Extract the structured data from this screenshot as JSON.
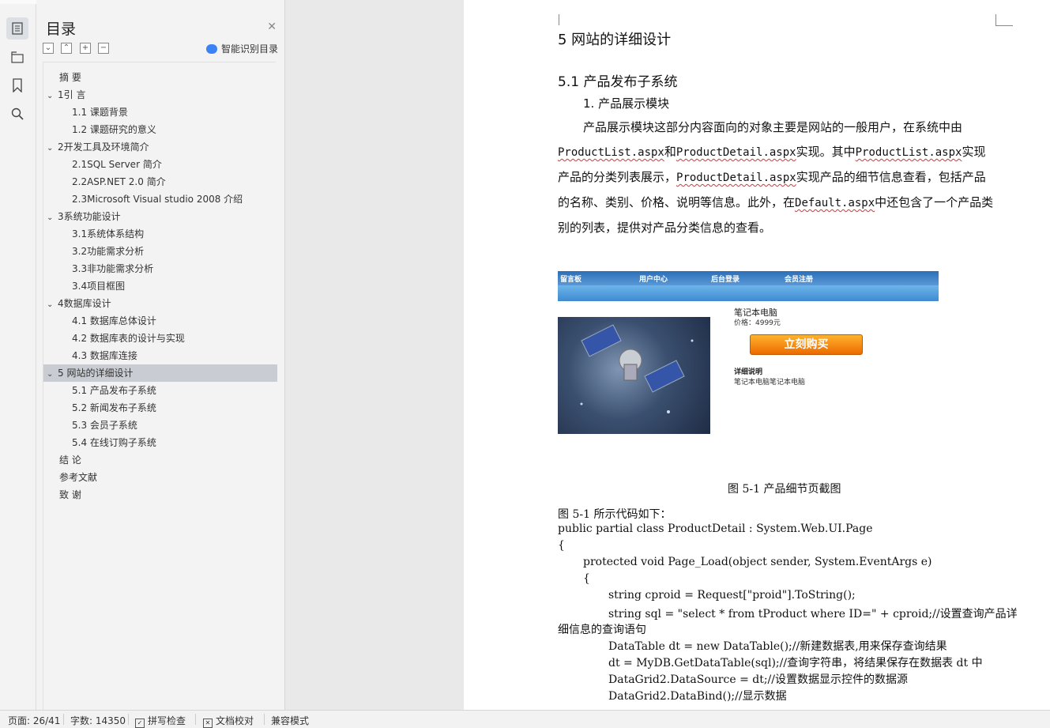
{
  "sidebar_icons": [
    "outline-icon",
    "navigation-icon",
    "bookmark-icon",
    "search-icon"
  ],
  "toc": {
    "title": "目录",
    "smart_label": "智能识别目录",
    "items": [
      {
        "label": "摘  要",
        "level": 0,
        "chev": ""
      },
      {
        "label": "1引  言",
        "level": 0,
        "chev": "v"
      },
      {
        "label": "1.1 课题背景",
        "level": 1,
        "chev": ""
      },
      {
        "label": "1.2  课题研究的意义",
        "level": 1,
        "chev": ""
      },
      {
        "label": "2开发工具及环境简介",
        "level": 0,
        "chev": "v"
      },
      {
        "label": "2.1SQL Server  简介",
        "level": 1,
        "chev": ""
      },
      {
        "label": "2.2ASP.NET 2.0 简介",
        "level": 1,
        "chev": ""
      },
      {
        "label": "2.3Microsoft Visual studio 2008  介绍",
        "level": 1,
        "chev": ""
      },
      {
        "label": "3系统功能设计",
        "level": 0,
        "chev": "v"
      },
      {
        "label": "3.1系统体系结构",
        "level": 1,
        "chev": ""
      },
      {
        "label": "3.2功能需求分析",
        "level": 1,
        "chev": ""
      },
      {
        "label": "3.3非功能需求分析",
        "level": 1,
        "chev": ""
      },
      {
        "label": "3.4项目框图",
        "level": 1,
        "chev": ""
      },
      {
        "label": "4数据库设计",
        "level": 0,
        "chev": "v"
      },
      {
        "label": "4.1 数据库总体设计",
        "level": 1,
        "chev": ""
      },
      {
        "label": "4.2 数据库表的设计与实现",
        "level": 1,
        "chev": ""
      },
      {
        "label": "4.3  数据库连接",
        "level": 1,
        "chev": ""
      },
      {
        "label": "5 网站的详细设计",
        "level": 0,
        "chev": "v",
        "selected": true
      },
      {
        "label": "5.1 产品发布子系统",
        "level": 1,
        "chev": ""
      },
      {
        "label": "5.2 新闻发布子系统",
        "level": 1,
        "chev": ""
      },
      {
        "label": "5.3  会员子系统",
        "level": 1,
        "chev": ""
      },
      {
        "label": "5.4 在线订购子系统",
        "level": 1,
        "chev": ""
      },
      {
        "label": "结  论",
        "level": 0,
        "chev": ""
      },
      {
        "label": "参考文献",
        "level": 0,
        "chev": ""
      },
      {
        "label": "致  谢",
        "level": 0,
        "chev": ""
      }
    ]
  },
  "document": {
    "h1": "5 网站的详细设计",
    "h2": "5.1 产品发布子系统",
    "h3": "1.  产品展示模块",
    "para": {
      "t1": "产品展示模块这部分内容面向的对象主要是网站的一般用户，在系统中由",
      "c1": "ProductList.aspx",
      "t2": "和",
      "c2": "ProductDetail.aspx",
      "t3": "实现。其中",
      "c3": "ProductList.aspx",
      "t4": "实现产品的分类列表展示，",
      "c4": "ProductDetail.aspx",
      "t5": "实现产品的细节信息查看，包括产品的名称、类别、价格、说明等信息。此外，在",
      "c5": "Default.aspx",
      "t6": "中还包含了一个产品类别的列表，提供对产品分类信息的查看。"
    },
    "screenshot": {
      "nav": [
        "留言板",
        "用户中心",
        "后台登录",
        "会员注册"
      ],
      "product_name": "笔记本电脑",
      "price": "价格：4999元",
      "buy_button": "立刻购买",
      "detail_title": "详细说明",
      "detail_text": "笔记本电脑笔记本电脑"
    },
    "caption": "图 5-1  产品细节页截图",
    "code_intro": "图 5-1 所示代码如下：",
    "code": [
      "public partial class ProductDetail : System.Web.UI.Page",
      "{",
      "protected void Page_Load(object sender, System.EventArgs e)",
      "{",
      "string cproid = Request[\"proid\"].ToString();",
      "string sql = \"select * from tProduct where ID=\" + cproid;//设置查询产品详",
      "细信息的查询语句",
      "DataTable dt = new DataTable();//新建数据表,用来保存查询结果",
      "dt = MyDB.GetDataTable(sql);//查询字符串，将结果保存在数据表 dt 中",
      "DataGrid2.DataSource = dt;//设置数据显示控件的数据源",
      "DataGrid2.DataBind();//显示数据"
    ]
  },
  "status": {
    "page": "页面: 26/41",
    "words": "字数: 14350",
    "spell": "拼写检查",
    "proof": "文档校对",
    "compat": "兼容模式"
  }
}
